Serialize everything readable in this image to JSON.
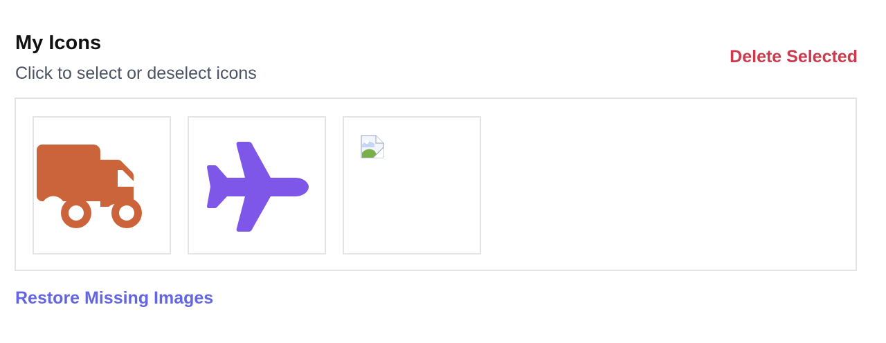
{
  "header": {
    "title": "My Icons",
    "subtitle": "Click to select or deselect icons",
    "delete_label": "Delete Selected"
  },
  "icons": [
    {
      "name": "truck-icon",
      "color": "#cc643b",
      "state": "loaded"
    },
    {
      "name": "airplane-icon",
      "color": "#7e57e8",
      "state": "loaded"
    },
    {
      "name": "broken-image-icon",
      "state": "missing"
    }
  ],
  "footer": {
    "restore_label": "Restore Missing Images"
  },
  "colors": {
    "delete": "#cc3a4d",
    "link": "#6366e0",
    "border": "#e4e4e4",
    "subtitle": "#4a5263"
  }
}
